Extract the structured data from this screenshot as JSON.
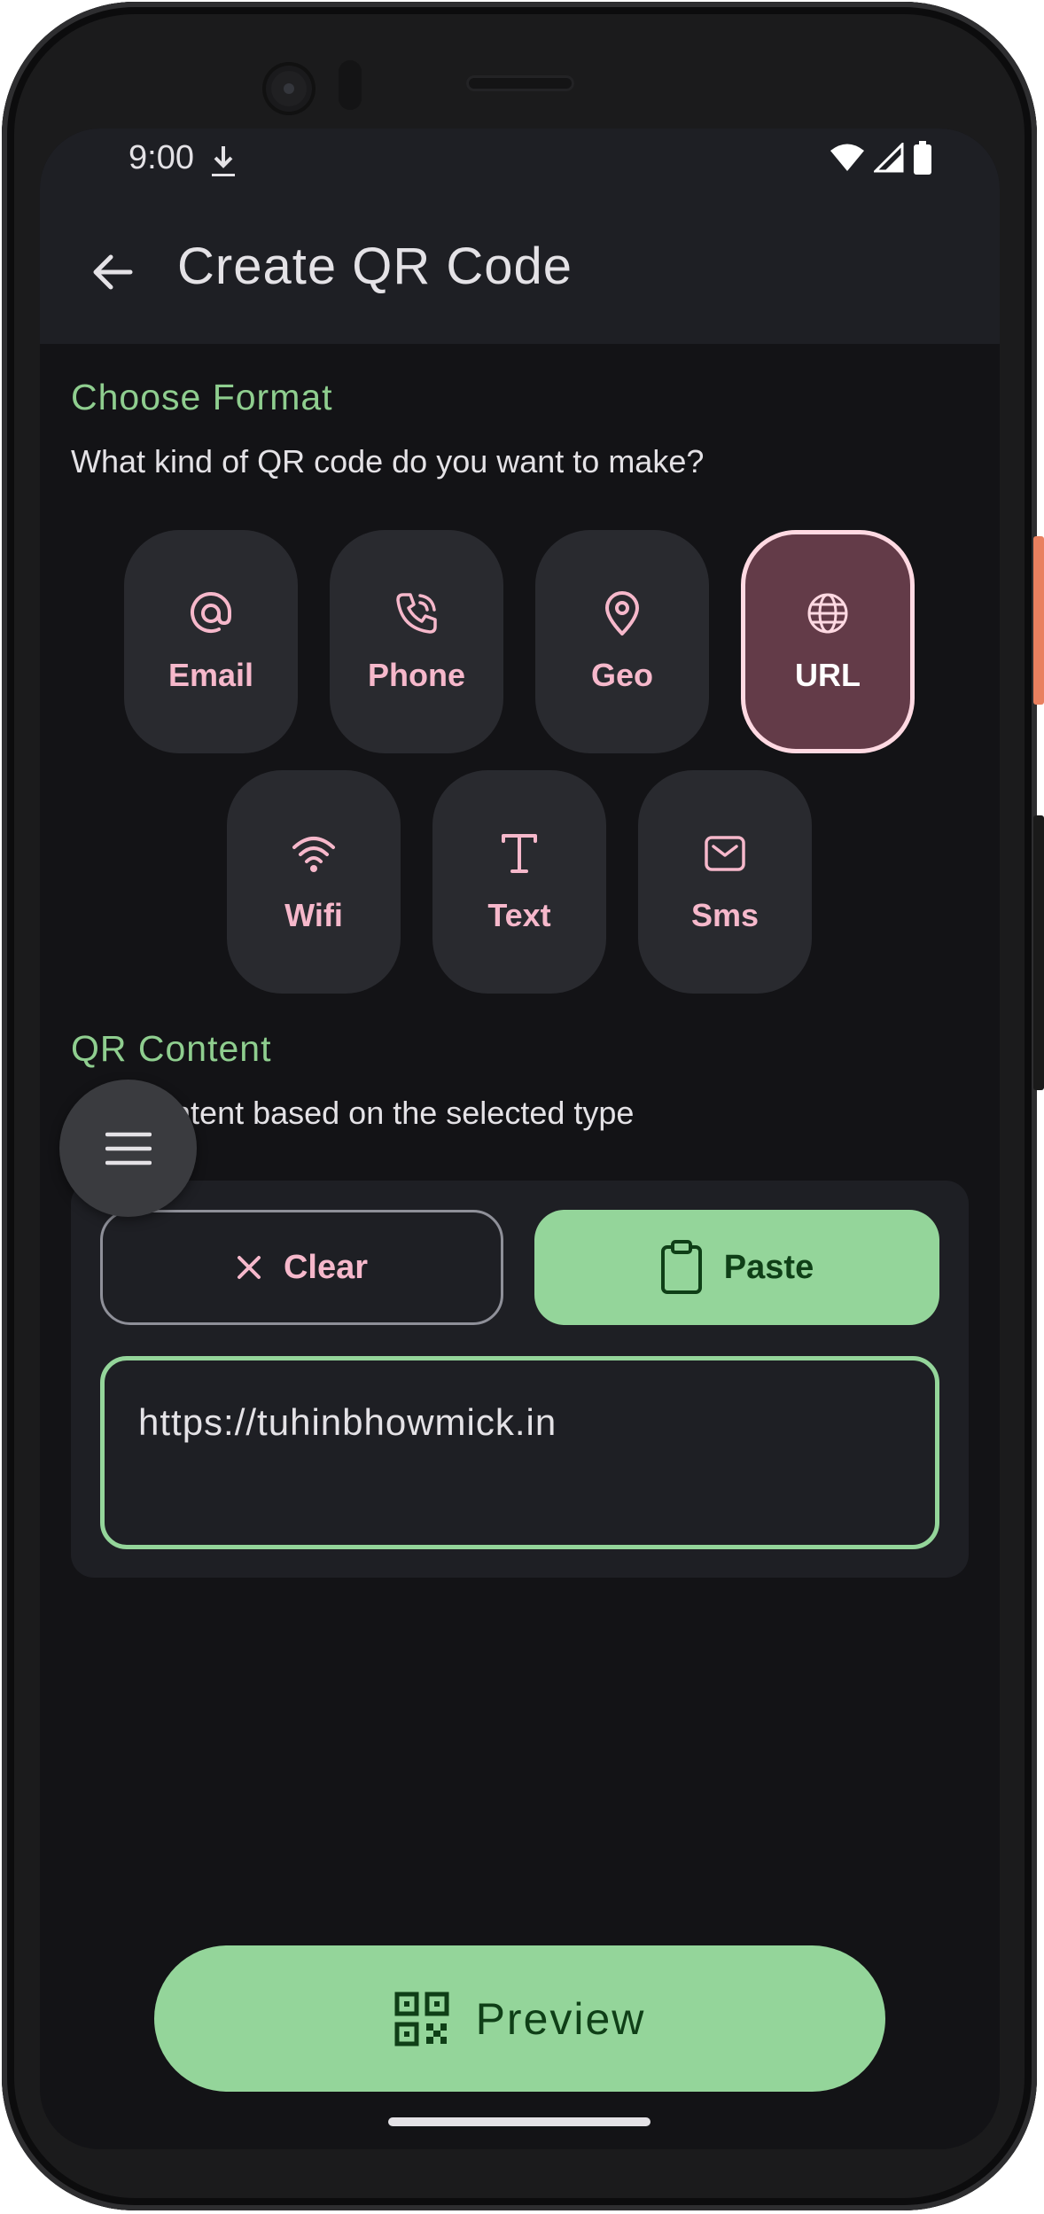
{
  "status_bar": {
    "time": "9:00"
  },
  "app_bar": {
    "title": "Create QR Code"
  },
  "format_section": {
    "title": "Choose Format",
    "subtitle": "What kind of QR code do you want to make?",
    "options": [
      {
        "label": "Email",
        "icon": "at-icon",
        "selected": false
      },
      {
        "label": "Phone",
        "icon": "phone-icon",
        "selected": false
      },
      {
        "label": "Geo",
        "icon": "location-pin-icon",
        "selected": false
      },
      {
        "label": "URL",
        "icon": "globe-icon",
        "selected": true
      },
      {
        "label": "Wifi",
        "icon": "wifi-icon",
        "selected": false
      },
      {
        "label": "Text",
        "icon": "text-icon",
        "selected": false
      },
      {
        "label": "Sms",
        "icon": "message-icon",
        "selected": false
      }
    ]
  },
  "content_section": {
    "title": "QR Content",
    "subtitle": "ontent based on the selected type",
    "clear_label": "Clear",
    "paste_label": "Paste",
    "input_value": "https://tuhinbhowmick.in"
  },
  "preview_button": {
    "label": "Preview"
  },
  "colors": {
    "accent_green": "#94d59a",
    "section_title_green": "#8fce8f",
    "chip_label_pink": "#f6b8cb",
    "selected_chip_bg": "#633b48",
    "background": "#131316"
  }
}
